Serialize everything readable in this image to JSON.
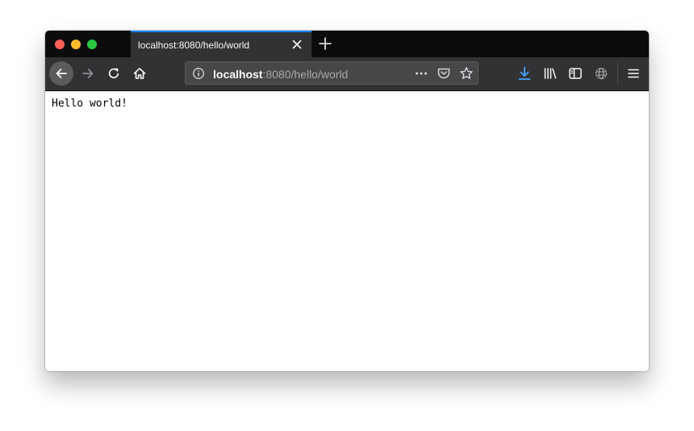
{
  "window": {
    "traffic_lights": {
      "close_color": "#fe5f57",
      "minimize_color": "#febc2e",
      "maximize_color": "#28c840"
    }
  },
  "tab": {
    "title": "localhost:8080/hello/world",
    "accent_color": "#0a84ff",
    "close_icon": "close-icon"
  },
  "toolbar": {
    "back_icon": "arrow-left-icon",
    "forward_icon": "arrow-right-icon",
    "reload_icon": "reload-icon",
    "home_icon": "home-icon",
    "url": {
      "host": "localhost",
      "path": ":8080/hello/world",
      "info_icon": "info-icon",
      "actions": [
        "more-icon",
        "pocket-icon",
        "star-icon"
      ]
    },
    "right_icons": [
      "download-icon",
      "library-icon",
      "sidebar-icon",
      "world-icon",
      "hamburger-menu-icon"
    ],
    "download_color": "#45a1ff"
  },
  "page": {
    "body_text": "Hello world!"
  }
}
